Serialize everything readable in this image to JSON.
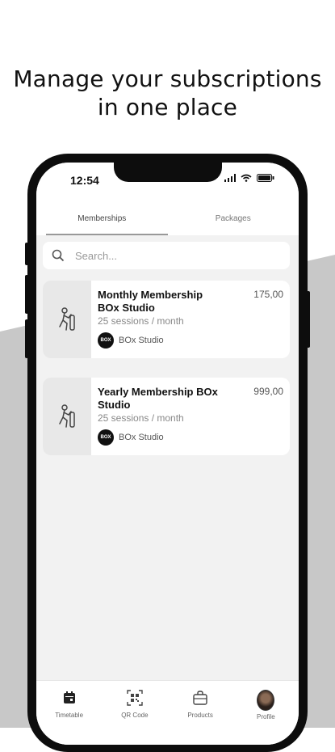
{
  "headline": {
    "line1": "Manage your subscriptions",
    "line2": "in one place"
  },
  "status_bar": {
    "time": "12:54",
    "icons": [
      "signal-icon",
      "wifi-icon",
      "battery-icon"
    ]
  },
  "tabs": [
    {
      "label": "Memberships",
      "active": true
    },
    {
      "label": "Packages",
      "active": false
    }
  ],
  "search": {
    "placeholder": "Search...",
    "value": ""
  },
  "memberships": [
    {
      "title": "Monthly Membership BOx Studio",
      "subtitle": "25 sessions / month",
      "studio": "BOx Studio",
      "logo_text": "BOX",
      "price": "175,00",
      "icon": "fitness-person-icon"
    },
    {
      "title": "Yearly Membership BOx Studio",
      "subtitle": "25 sessions / month",
      "studio": "BOx Studio",
      "logo_text": "BOX",
      "price": "999,00",
      "icon": "fitness-person-icon"
    }
  ],
  "nav": [
    {
      "label": "Timetable",
      "icon": "calendar-icon"
    },
    {
      "label": "QR Code",
      "icon": "qr-code-icon"
    },
    {
      "label": "Products",
      "icon": "shopping-bag-icon"
    },
    {
      "label": "Profile",
      "icon": "avatar"
    }
  ],
  "colors": {
    "background_wedge": "#c8c8c8",
    "phone_frame": "#0d0d0d",
    "screen_bg": "#f2f2f2",
    "card_bg": "#ffffff"
  }
}
